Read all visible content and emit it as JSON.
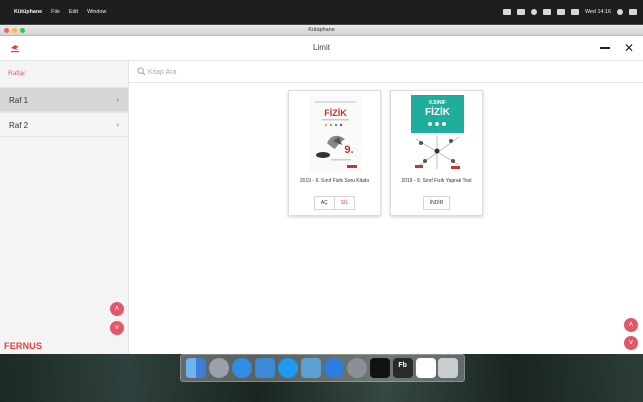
{
  "menubar": {
    "app_name": "Kütüphane",
    "items": [
      "File",
      "Edit",
      "Window"
    ],
    "clock": "Wed 14:16"
  },
  "window": {
    "title": "Kütüphane"
  },
  "header": {
    "title": "Limit"
  },
  "sidebar": {
    "section_label": "Raflar",
    "items": [
      {
        "label": "Raf 1",
        "selected": true
      },
      {
        "label": "Raf 2",
        "selected": false
      }
    ],
    "brand": "FERNUS"
  },
  "search": {
    "placeholder": "Kitap Ara",
    "value": ""
  },
  "books": [
    {
      "title": "2019 - 9. Sınıf Fizik Soru Kitabı",
      "cover_text": "FİZİK",
      "cover_badge": "9.",
      "actions": [
        "AÇ",
        "SİL"
      ]
    },
    {
      "title": "2019 - 9. Sınıf Fizik Yaprak Test",
      "cover_top": "9.SINIF",
      "cover_text": "FİZİK",
      "actions": [
        "İNDİR"
      ]
    }
  ],
  "colors": {
    "accent": "#e4576a",
    "brand_red": "#e0403e",
    "teal_cover": "#1fae9e"
  },
  "dock": [
    "Finder",
    "Launchpad",
    "Safari",
    "Xcode",
    "App Store",
    "Activity",
    "Transmit",
    "System Preferences",
    "Terminal",
    "Fb",
    "Limit",
    "Trash"
  ]
}
